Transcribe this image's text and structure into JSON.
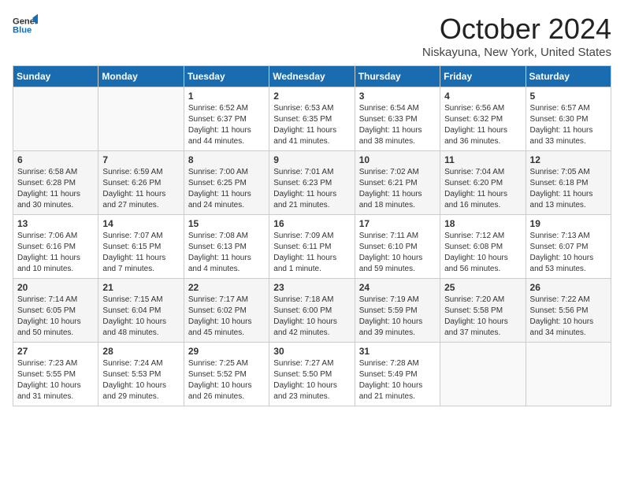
{
  "header": {
    "logo_general": "General",
    "logo_blue": "Blue",
    "month": "October 2024",
    "location": "Niskayuna, New York, United States"
  },
  "weekdays": [
    "Sunday",
    "Monday",
    "Tuesday",
    "Wednesday",
    "Thursday",
    "Friday",
    "Saturday"
  ],
  "weeks": [
    [
      {
        "day": "",
        "sunrise": "",
        "sunset": "",
        "daylight": ""
      },
      {
        "day": "",
        "sunrise": "",
        "sunset": "",
        "daylight": ""
      },
      {
        "day": "1",
        "sunrise": "Sunrise: 6:52 AM",
        "sunset": "Sunset: 6:37 PM",
        "daylight": "Daylight: 11 hours and 44 minutes."
      },
      {
        "day": "2",
        "sunrise": "Sunrise: 6:53 AM",
        "sunset": "Sunset: 6:35 PM",
        "daylight": "Daylight: 11 hours and 41 minutes."
      },
      {
        "day": "3",
        "sunrise": "Sunrise: 6:54 AM",
        "sunset": "Sunset: 6:33 PM",
        "daylight": "Daylight: 11 hours and 38 minutes."
      },
      {
        "day": "4",
        "sunrise": "Sunrise: 6:56 AM",
        "sunset": "Sunset: 6:32 PM",
        "daylight": "Daylight: 11 hours and 36 minutes."
      },
      {
        "day": "5",
        "sunrise": "Sunrise: 6:57 AM",
        "sunset": "Sunset: 6:30 PM",
        "daylight": "Daylight: 11 hours and 33 minutes."
      }
    ],
    [
      {
        "day": "6",
        "sunrise": "Sunrise: 6:58 AM",
        "sunset": "Sunset: 6:28 PM",
        "daylight": "Daylight: 11 hours and 30 minutes."
      },
      {
        "day": "7",
        "sunrise": "Sunrise: 6:59 AM",
        "sunset": "Sunset: 6:26 PM",
        "daylight": "Daylight: 11 hours and 27 minutes."
      },
      {
        "day": "8",
        "sunrise": "Sunrise: 7:00 AM",
        "sunset": "Sunset: 6:25 PM",
        "daylight": "Daylight: 11 hours and 24 minutes."
      },
      {
        "day": "9",
        "sunrise": "Sunrise: 7:01 AM",
        "sunset": "Sunset: 6:23 PM",
        "daylight": "Daylight: 11 hours and 21 minutes."
      },
      {
        "day": "10",
        "sunrise": "Sunrise: 7:02 AM",
        "sunset": "Sunset: 6:21 PM",
        "daylight": "Daylight: 11 hours and 18 minutes."
      },
      {
        "day": "11",
        "sunrise": "Sunrise: 7:04 AM",
        "sunset": "Sunset: 6:20 PM",
        "daylight": "Daylight: 11 hours and 16 minutes."
      },
      {
        "day": "12",
        "sunrise": "Sunrise: 7:05 AM",
        "sunset": "Sunset: 6:18 PM",
        "daylight": "Daylight: 11 hours and 13 minutes."
      }
    ],
    [
      {
        "day": "13",
        "sunrise": "Sunrise: 7:06 AM",
        "sunset": "Sunset: 6:16 PM",
        "daylight": "Daylight: 11 hours and 10 minutes."
      },
      {
        "day": "14",
        "sunrise": "Sunrise: 7:07 AM",
        "sunset": "Sunset: 6:15 PM",
        "daylight": "Daylight: 11 hours and 7 minutes."
      },
      {
        "day": "15",
        "sunrise": "Sunrise: 7:08 AM",
        "sunset": "Sunset: 6:13 PM",
        "daylight": "Daylight: 11 hours and 4 minutes."
      },
      {
        "day": "16",
        "sunrise": "Sunrise: 7:09 AM",
        "sunset": "Sunset: 6:11 PM",
        "daylight": "Daylight: 11 hours and 1 minute."
      },
      {
        "day": "17",
        "sunrise": "Sunrise: 7:11 AM",
        "sunset": "Sunset: 6:10 PM",
        "daylight": "Daylight: 10 hours and 59 minutes."
      },
      {
        "day": "18",
        "sunrise": "Sunrise: 7:12 AM",
        "sunset": "Sunset: 6:08 PM",
        "daylight": "Daylight: 10 hours and 56 minutes."
      },
      {
        "day": "19",
        "sunrise": "Sunrise: 7:13 AM",
        "sunset": "Sunset: 6:07 PM",
        "daylight": "Daylight: 10 hours and 53 minutes."
      }
    ],
    [
      {
        "day": "20",
        "sunrise": "Sunrise: 7:14 AM",
        "sunset": "Sunset: 6:05 PM",
        "daylight": "Daylight: 10 hours and 50 minutes."
      },
      {
        "day": "21",
        "sunrise": "Sunrise: 7:15 AM",
        "sunset": "Sunset: 6:04 PM",
        "daylight": "Daylight: 10 hours and 48 minutes."
      },
      {
        "day": "22",
        "sunrise": "Sunrise: 7:17 AM",
        "sunset": "Sunset: 6:02 PM",
        "daylight": "Daylight: 10 hours and 45 minutes."
      },
      {
        "day": "23",
        "sunrise": "Sunrise: 7:18 AM",
        "sunset": "Sunset: 6:00 PM",
        "daylight": "Daylight: 10 hours and 42 minutes."
      },
      {
        "day": "24",
        "sunrise": "Sunrise: 7:19 AM",
        "sunset": "Sunset: 5:59 PM",
        "daylight": "Daylight: 10 hours and 39 minutes."
      },
      {
        "day": "25",
        "sunrise": "Sunrise: 7:20 AM",
        "sunset": "Sunset: 5:58 PM",
        "daylight": "Daylight: 10 hours and 37 minutes."
      },
      {
        "day": "26",
        "sunrise": "Sunrise: 7:22 AM",
        "sunset": "Sunset: 5:56 PM",
        "daylight": "Daylight: 10 hours and 34 minutes."
      }
    ],
    [
      {
        "day": "27",
        "sunrise": "Sunrise: 7:23 AM",
        "sunset": "Sunset: 5:55 PM",
        "daylight": "Daylight: 10 hours and 31 minutes."
      },
      {
        "day": "28",
        "sunrise": "Sunrise: 7:24 AM",
        "sunset": "Sunset: 5:53 PM",
        "daylight": "Daylight: 10 hours and 29 minutes."
      },
      {
        "day": "29",
        "sunrise": "Sunrise: 7:25 AM",
        "sunset": "Sunset: 5:52 PM",
        "daylight": "Daylight: 10 hours and 26 minutes."
      },
      {
        "day": "30",
        "sunrise": "Sunrise: 7:27 AM",
        "sunset": "Sunset: 5:50 PM",
        "daylight": "Daylight: 10 hours and 23 minutes."
      },
      {
        "day": "31",
        "sunrise": "Sunrise: 7:28 AM",
        "sunset": "Sunset: 5:49 PM",
        "daylight": "Daylight: 10 hours and 21 minutes."
      },
      {
        "day": "",
        "sunrise": "",
        "sunset": "",
        "daylight": ""
      },
      {
        "day": "",
        "sunrise": "",
        "sunset": "",
        "daylight": ""
      }
    ]
  ]
}
